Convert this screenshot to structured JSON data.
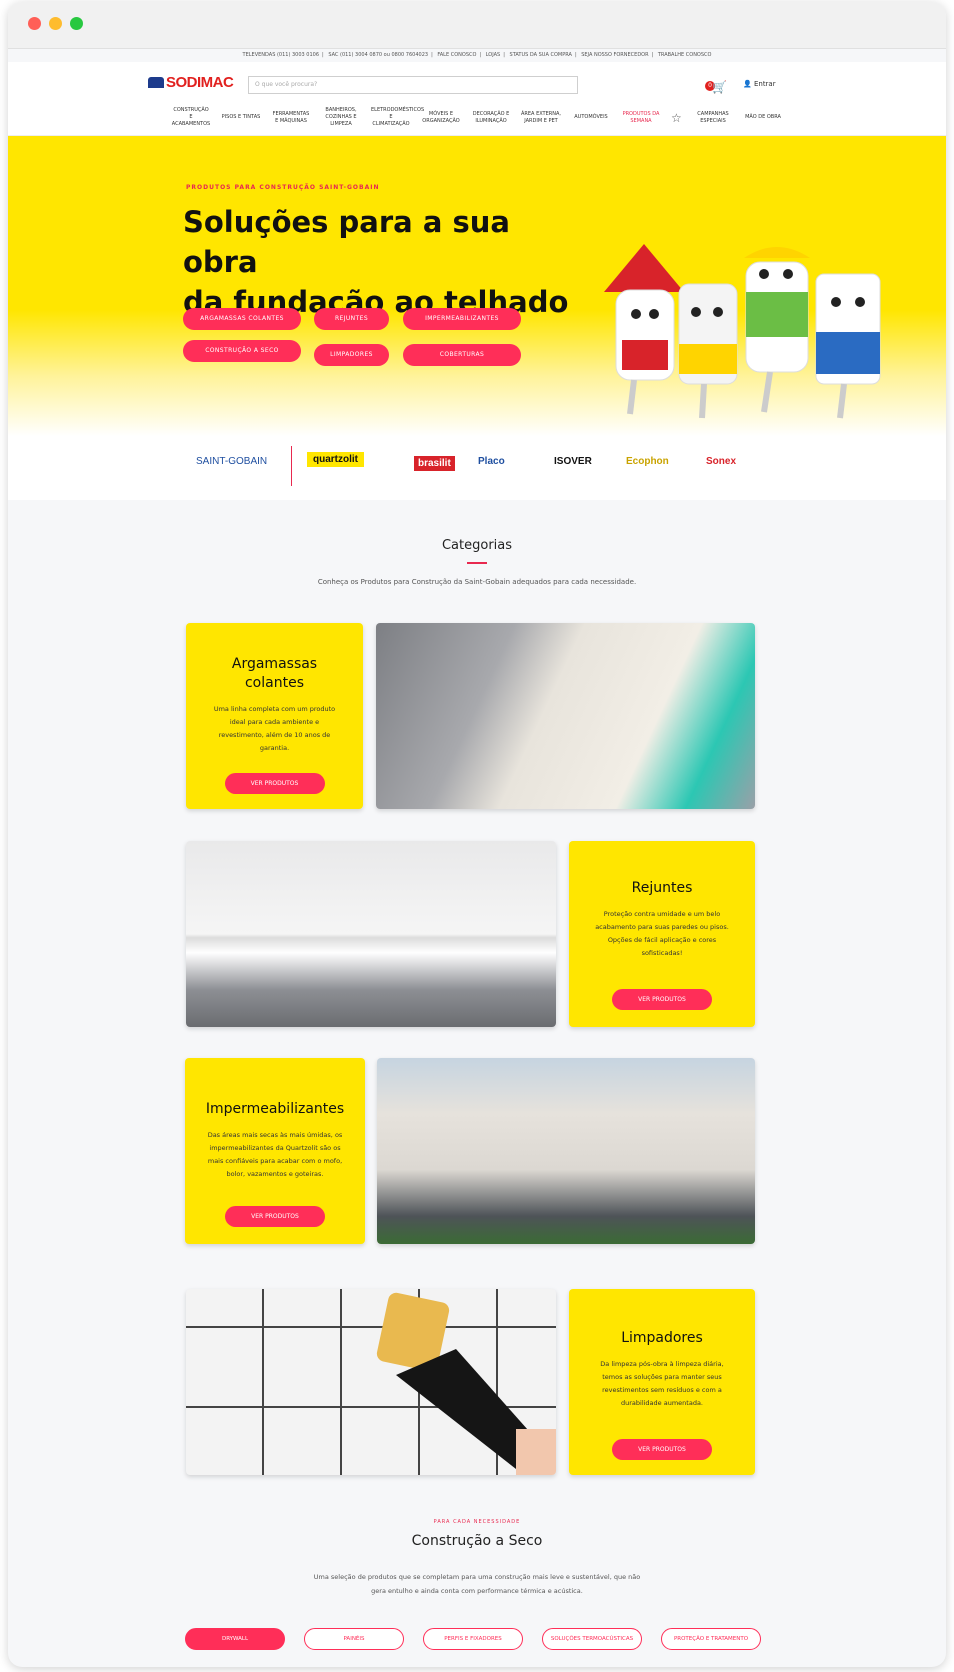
{
  "topbar": [
    "TELEVENDAS (011) 3003 0106",
    "SAC (011) 3004 0870 ou 0800 7604023",
    "FALE CONOSCO",
    "LOJAS",
    "STATUS DA SUA COMPRA",
    "SEJA NOSSO FORNECEDOR",
    "TRABALHE CONOSCO"
  ],
  "header": {
    "logo": "SODIMAC",
    "search_placeholder": "O que você procura?",
    "cart_count": "0",
    "login": "Entrar"
  },
  "nav": [
    "CONSTRUÇÃO E ACABAMENTOS",
    "PISOS E TINTAS",
    "FERRAMENTAS E MÁQUINAS",
    "BANHEIROS, COZINHAS E LIMPEZA",
    "ELETRODOMÉSTICOS E CLIMATIZAÇÃO",
    "MÓVEIS E ORGANIZAÇÃO",
    "DECORAÇÃO E ILUMINAÇÃO",
    "ÁREA EXTERNA, JARDIM E PET",
    "AUTOMÓVEIS",
    "PRODUTOS DA SEMANA",
    "CAMPANHAS ESPECIAIS",
    "MÃO DE OBRA"
  ],
  "hero": {
    "kicker": "PRODUTOS PARA CONSTRUÇÃO SAINT-GOBAIN",
    "title_line1": "Soluções para a sua obra",
    "title_line2": "da fundação ao telhado",
    "pills": [
      "ARGAMASSAS COLANTES",
      "REJUNTES",
      "IMPERMEABILIZANTES",
      "CONSTRUÇÃO A SECO",
      "LIMPADORES",
      "COBERTURAS"
    ]
  },
  "brands": [
    "SAINT-GOBAIN",
    "quartzolit",
    "brasilit",
    "Placo",
    "ISOVER",
    "Ecophon",
    "Sonex"
  ],
  "categories": {
    "title": "Categorias",
    "subtitle": "Conheça os Produtos para Construção da Saint-Gobain adequados para cada necessidade.",
    "cards": [
      {
        "title": "Argamassas colantes",
        "text": "Uma linha completa com um produto ideal para cada ambiente e revestimento, além de 10 anos de garantia.",
        "button": "VER PRODUTOS"
      },
      {
        "title": "Rejuntes",
        "text": "Proteção contra umidade e um belo acabamento para suas paredes ou pisos. Opções de fácil aplicação e cores sofisticadas!",
        "button": "VER PRODUTOS"
      },
      {
        "title": "Impermeabilizantes",
        "text": "Das áreas mais secas às mais úmidas, os impermeabilizantes da Quartzolit são os mais confiáveis para acabar com o mofo, bolor, vazamentos e goteiras.",
        "button": "VER PRODUTOS"
      },
      {
        "title": "Limpadores",
        "text": "Da limpeza pós-obra à limpeza diária, temos as soluções para manter seus revestimentos sem resíduos e com a durabilidade aumentada.",
        "button": "VER PRODUTOS"
      }
    ]
  },
  "seco": {
    "kicker": "PARA CADA NECESSIDADE",
    "title": "Construção a Seco",
    "text": "Uma seleção de produtos que se completam para uma construção mais leve e sustentável, que não gera entulho e ainda conta com performance térmica e acústica.",
    "tabs": [
      "DRYWALL",
      "PAINÉIS",
      "PERFIS E FIXADORES",
      "SOLUÇÕES TERMOACÚSTICAS",
      "PROTEÇÃO E TRATAMENTO"
    ]
  },
  "colors": {
    "accent": "#ff2e58",
    "yellow": "#ffe600",
    "brand_red": "#e1211f"
  }
}
